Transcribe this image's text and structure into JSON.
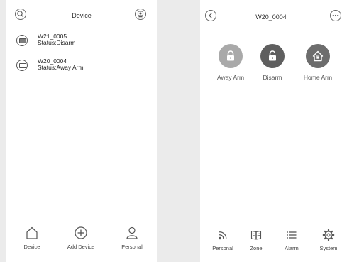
{
  "left_screen": {
    "header": {
      "title": "Device",
      "search_icon": "search-icon",
      "camera_icon": "camera-icon"
    },
    "devices": [
      {
        "name": "W21_0005",
        "status": "Status:Disarm",
        "icon": "device-armed-icon"
      },
      {
        "name": "W20_0004",
        "status": "Status:Away Arm",
        "icon": "device-icon"
      }
    ],
    "nav": [
      {
        "label": "Device",
        "icon": "home-icon"
      },
      {
        "label": "Add Device",
        "icon": "add-circle-icon"
      },
      {
        "label": "Personal",
        "icon": "person-icon"
      }
    ]
  },
  "right_screen": {
    "header": {
      "title": "W20_0004",
      "back_icon": "back-icon",
      "more_icon": "more-icon"
    },
    "arm_buttons": [
      {
        "label": "Away Arm",
        "icon": "lock-icon",
        "color": "#a9a9a9"
      },
      {
        "label": "Disarm",
        "icon": "unlock-icon",
        "color": "#5f5f5f"
      },
      {
        "label": "Home Arm",
        "icon": "home-lock-icon",
        "color": "#6d6d6d"
      }
    ],
    "nav": [
      {
        "label": "Personal",
        "icon": "signal-icon"
      },
      {
        "label": "Zone",
        "icon": "zone-book-icon"
      },
      {
        "label": "Alarm",
        "icon": "alarm-list-icon"
      },
      {
        "label": "System",
        "icon": "gear-icon"
      }
    ]
  }
}
